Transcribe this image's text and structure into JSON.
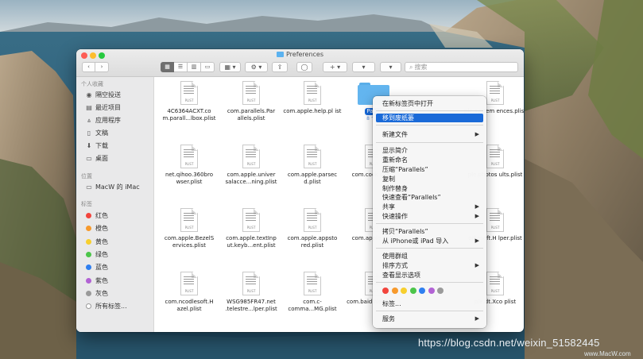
{
  "window": {
    "title": "Preferences"
  },
  "toolbar": {
    "back": "‹",
    "forward": "›",
    "view_icons": [
      "▦",
      "☰",
      "▥",
      "▭"
    ],
    "group_label": "▦ ▾",
    "action_label": "⚙ ▾",
    "share_label": "⇪",
    "tag_label": "◯",
    "plus_label": "+ ▾",
    "menu1_label": "▾",
    "menu2_label": "▾",
    "search_placeholder": "搜索",
    "search_icon": "search-icon"
  },
  "sidebar": {
    "favorites_header": "个人收藏",
    "favorites": [
      {
        "label": "隔空投送",
        "icon": "airdrop-icon",
        "glyph": "◉"
      },
      {
        "label": "最近项目",
        "icon": "recents-icon",
        "glyph": "▤"
      },
      {
        "label": "应用程序",
        "icon": "applications-icon",
        "glyph": "⩓"
      },
      {
        "label": "文稿",
        "icon": "documents-icon",
        "glyph": "▯"
      },
      {
        "label": "下载",
        "icon": "downloads-icon",
        "glyph": "⬇"
      },
      {
        "label": "桌面",
        "icon": "desktop-icon",
        "glyph": "▭"
      }
    ],
    "locations_header": "位置",
    "locations": [
      {
        "label": "MacW 的 iMac",
        "icon": "imac-icon",
        "glyph": "▭"
      }
    ],
    "tags_header": "标签",
    "tags": [
      {
        "label": "红色",
        "color": "#f2453d"
      },
      {
        "label": "橙色",
        "color": "#f79a2d"
      },
      {
        "label": "黄色",
        "color": "#f7cf2e"
      },
      {
        "label": "绿色",
        "color": "#4cc54a"
      },
      {
        "label": "蓝色",
        "color": "#2f7ff0"
      },
      {
        "label": "紫色",
        "color": "#b263d4"
      },
      {
        "label": "灰色",
        "color": "#9a9a9a"
      },
      {
        "label": "所有标签...",
        "color": ""
      }
    ]
  },
  "files": [
    {
      "name": "4C6364ACXT.co m.parall...lbox.plist",
      "type": "plist"
    },
    {
      "name": "com.parallels.Par allels.plist",
      "type": "plist"
    },
    {
      "name": "com.apple.help.pl ist",
      "type": "plist"
    },
    {
      "name": "Paral",
      "type": "folder",
      "subtitle": "8 个项"
    },
    {
      "name": "",
      "type": "hidden"
    },
    {
      "name": "ple.system ences.plist",
      "type": "plist"
    },
    {
      "name": "net.qihoo.360bro wser.plist",
      "type": "plist"
    },
    {
      "name": "com.apple.univer salacce...ning.plist",
      "type": "plist"
    },
    {
      "name": "com.apple.parsec d.plist",
      "type": "plist"
    },
    {
      "name": "com.cock cap.p",
      "type": "plist"
    },
    {
      "name": "",
      "type": "hidden"
    },
    {
      "name": "ple.photos ults.plist",
      "type": "plist"
    },
    {
      "name": "com.apple.BezelS ervices.plist",
      "type": "plist"
    },
    {
      "name": "com.apple.textInp ut.keyb...ent.plist",
      "type": "plist"
    },
    {
      "name": "com.apple.appsto red.plist",
      "type": "plist"
    },
    {
      "name": "com.apple nt.pl",
      "type": "plist"
    },
    {
      "name": "",
      "type": "hidden"
    },
    {
      "name": "odlesoft.H lper.plist",
      "type": "plist"
    },
    {
      "name": "com.ncodlesoft.H azel.plist",
      "type": "plist"
    },
    {
      "name": "WSG985FR47.net .telestre...lper.plist",
      "type": "plist"
    },
    {
      "name": "com.c- comma...MG.plist",
      "type": "plist"
    },
    {
      "name": "com.baid Netdisk-n",
      "type": "plist"
    },
    {
      "name": "",
      "type": "hidden"
    },
    {
      "name": "ple.dt.Xco plist",
      "type": "plist"
    }
  ],
  "doc_ext": "PLIST",
  "context_menu": {
    "items": [
      {
        "label": "在新标签页中打开",
        "submenu": false,
        "highlighted": false
      },
      {
        "label": "移到废纸篓",
        "submenu": false,
        "highlighted": true
      },
      {
        "label": "新建文件",
        "submenu": true,
        "highlighted": false
      },
      {
        "label": "显示简介",
        "submenu": false,
        "highlighted": false
      },
      {
        "label": "重新命名",
        "submenu": false,
        "highlighted": false
      },
      {
        "label": "压缩“Parallels”",
        "submenu": false,
        "highlighted": false
      },
      {
        "label": "复制",
        "submenu": false,
        "highlighted": false
      },
      {
        "label": "制作替身",
        "submenu": false,
        "highlighted": false
      },
      {
        "label": "快速查看“Parallels”",
        "submenu": false,
        "highlighted": false
      },
      {
        "label": "共享",
        "submenu": true,
        "highlighted": false
      },
      {
        "label": "快速操作",
        "submenu": true,
        "highlighted": false
      },
      {
        "label": "拷贝“Parallels”",
        "submenu": false,
        "highlighted": false
      },
      {
        "label": "从 iPhone或 iPad 导入",
        "submenu": true,
        "highlighted": false
      },
      {
        "label": "使用群组",
        "submenu": false,
        "highlighted": false
      },
      {
        "label": "排序方式",
        "submenu": true,
        "highlighted": false
      },
      {
        "label": "查看显示选项",
        "submenu": false,
        "highlighted": false
      },
      {
        "label": "标签...",
        "submenu": false,
        "highlighted": false
      },
      {
        "label": "服务",
        "submenu": true,
        "highlighted": false
      }
    ],
    "tag_colors": [
      "#f2453d",
      "#f79a2d",
      "#f7cf2e",
      "#4cc54a",
      "#2f7ff0",
      "#b263d4",
      "#9a9a9a"
    ],
    "arrow": "▶"
  },
  "watermark": {
    "url": "https://blog.csdn.net/weixin_51582445",
    "site": "www.MacW.com"
  }
}
